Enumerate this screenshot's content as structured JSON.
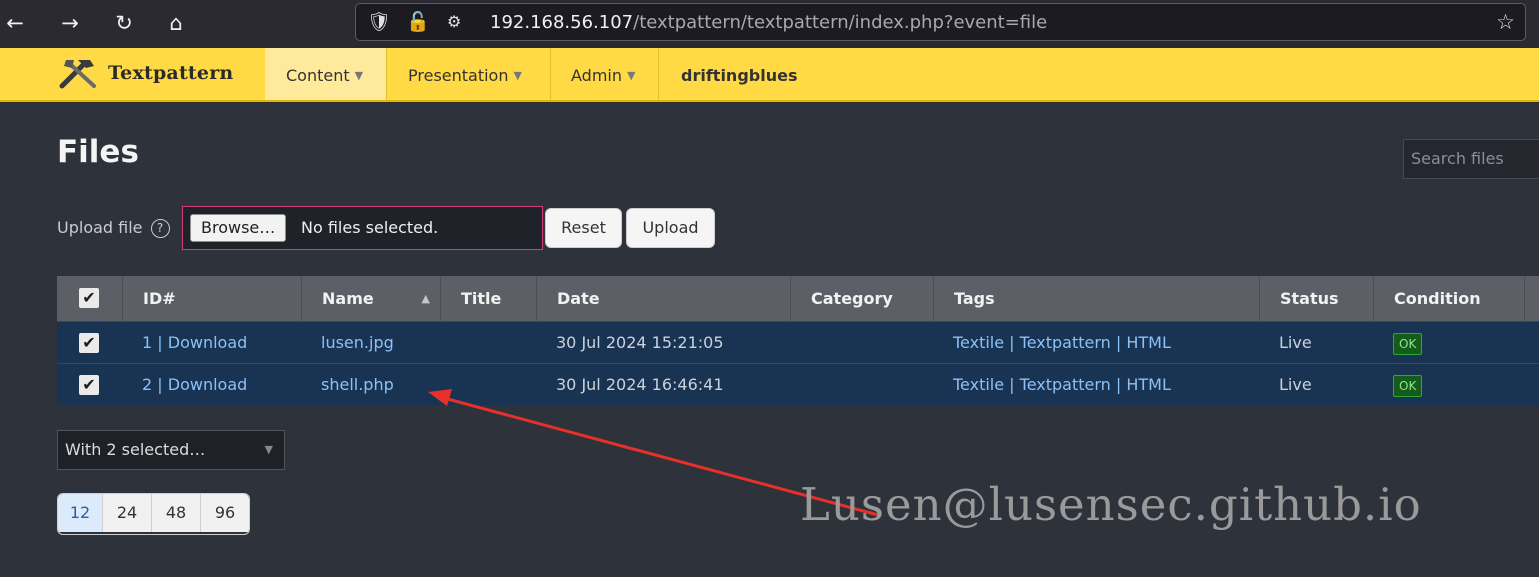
{
  "browser": {
    "url_host": "192.168.56.107",
    "url_path": "/textpattern/textpattern/index.php?event=file",
    "back_icon": "arrow-left-icon",
    "forward_icon": "arrow-right-icon",
    "reload_icon": "reload-icon",
    "home_icon": "home-icon",
    "bookmark_icon": "star-icon"
  },
  "header": {
    "brand": "Textpattern",
    "menu": [
      {
        "label": "Content"
      },
      {
        "label": "Presentation"
      },
      {
        "label": "Admin"
      }
    ],
    "user": "driftingblues"
  },
  "page": {
    "title": "Files",
    "search_placeholder": "Search files"
  },
  "upload": {
    "label": "Upload file",
    "help": "?",
    "browse_label": "Browse…",
    "file_status": "No files selected.",
    "reset_label": "Reset",
    "upload_label": "Upload"
  },
  "table": {
    "columns": [
      "ID#",
      "Name",
      "Title",
      "Date",
      "Category",
      "Tags",
      "Status",
      "Condition"
    ],
    "rows": [
      {
        "id": "1 | Download",
        "name": "lusen.jpg",
        "title": "",
        "date": "30 Jul 2024 15:21:05",
        "category": "",
        "tags": "Textile | Textpattern | HTML",
        "status": "Live",
        "condition": "OK"
      },
      {
        "id": "2 | Download",
        "name": "shell.php",
        "title": "",
        "date": "30 Jul 2024 16:46:41",
        "category": "",
        "tags": "Textile | Textpattern | HTML",
        "status": "Live",
        "condition": "OK"
      }
    ]
  },
  "bulk": {
    "label": "With 2 selected…"
  },
  "pager": [
    "12",
    "24",
    "48",
    "96"
  ],
  "annotation": {
    "watermark": "Lusen@lusensec.github.io",
    "arrow_color": "#e8302a"
  }
}
